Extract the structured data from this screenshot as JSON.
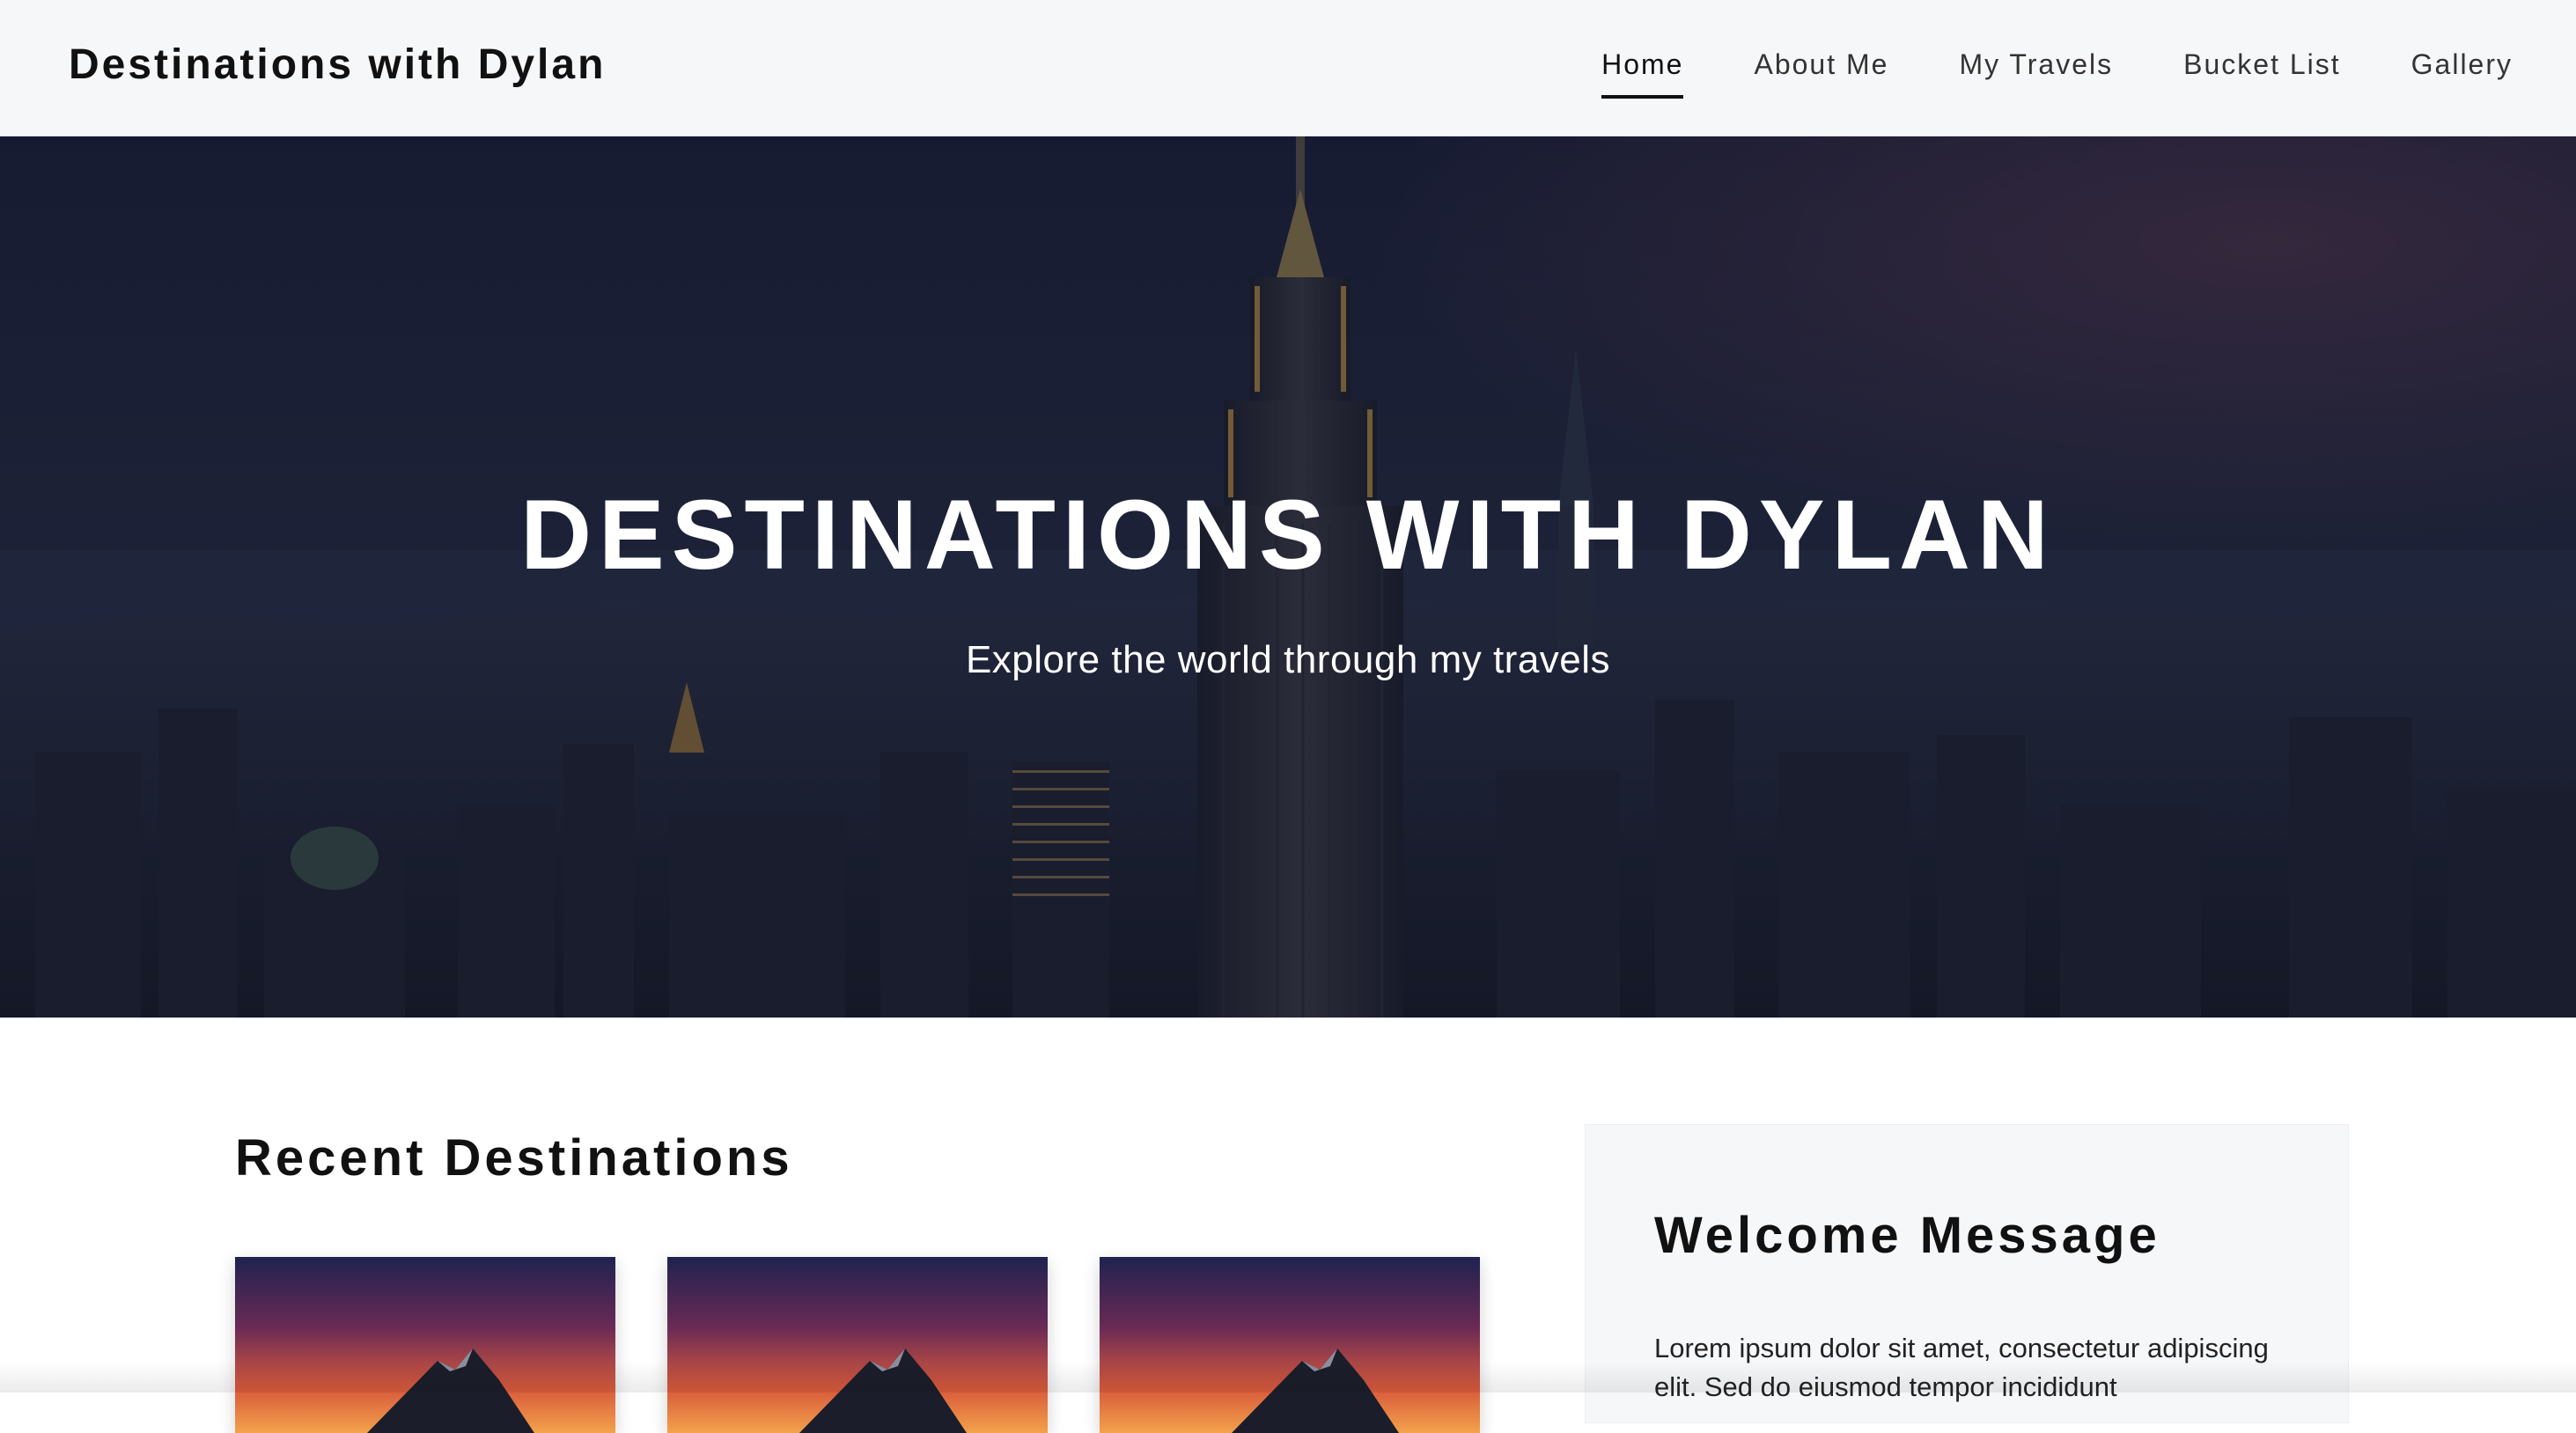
{
  "nav": {
    "brand": "Destinations with Dylan",
    "links": [
      {
        "label": "Home",
        "active": true
      },
      {
        "label": "About Me",
        "active": false
      },
      {
        "label": "My Travels",
        "active": false
      },
      {
        "label": "Bucket List",
        "active": false
      },
      {
        "label": "Gallery",
        "active": false
      }
    ]
  },
  "hero": {
    "title": "DESTINATIONS WITH DYLAN",
    "subtitle": "Explore the world through my travels"
  },
  "recent": {
    "title": "Recent Destinations",
    "cards": [
      {
        "image": "mountain-sunset"
      },
      {
        "image": "mountain-sunset"
      },
      {
        "image": "mountain-sunset"
      }
    ]
  },
  "welcome": {
    "title": "Welcome Message",
    "text": "Lorem ipsum dolor sit amet, consectetur adipiscing elit. Sed do eiusmod tempor incididunt"
  },
  "colors": {
    "nav_bg": "#f6f7f9",
    "hero_overlay": "#1a2035",
    "text_dark": "#111111",
    "panel_bg": "#f6f7f9"
  }
}
